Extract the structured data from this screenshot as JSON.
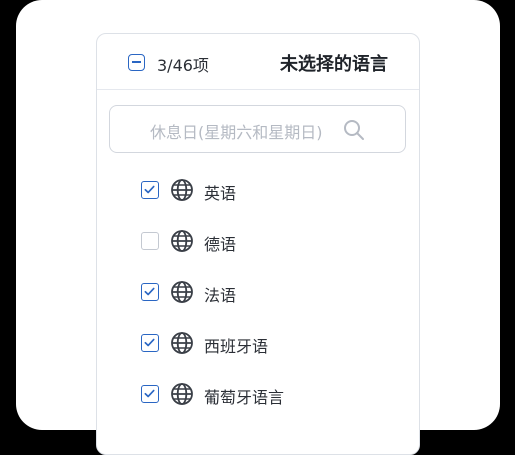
{
  "header": {
    "count": "3/46项",
    "title": "未选择的语言"
  },
  "search": {
    "placeholder": "休息日(星期六和星期日)"
  },
  "languages": [
    {
      "label": "英语",
      "checked": true
    },
    {
      "label": "德语",
      "checked": false
    },
    {
      "label": "法语",
      "checked": true
    },
    {
      "label": "西班牙语",
      "checked": true
    },
    {
      "label": "葡萄牙语言",
      "checked": true
    }
  ],
  "colors": {
    "accent": "#2a66c3",
    "text": "#2b2f36",
    "placeholder": "#b5bac3"
  },
  "icons": {
    "header_toggle": "indeterminate-checkbox-icon",
    "search": "search-icon",
    "language": "globe-icon"
  }
}
